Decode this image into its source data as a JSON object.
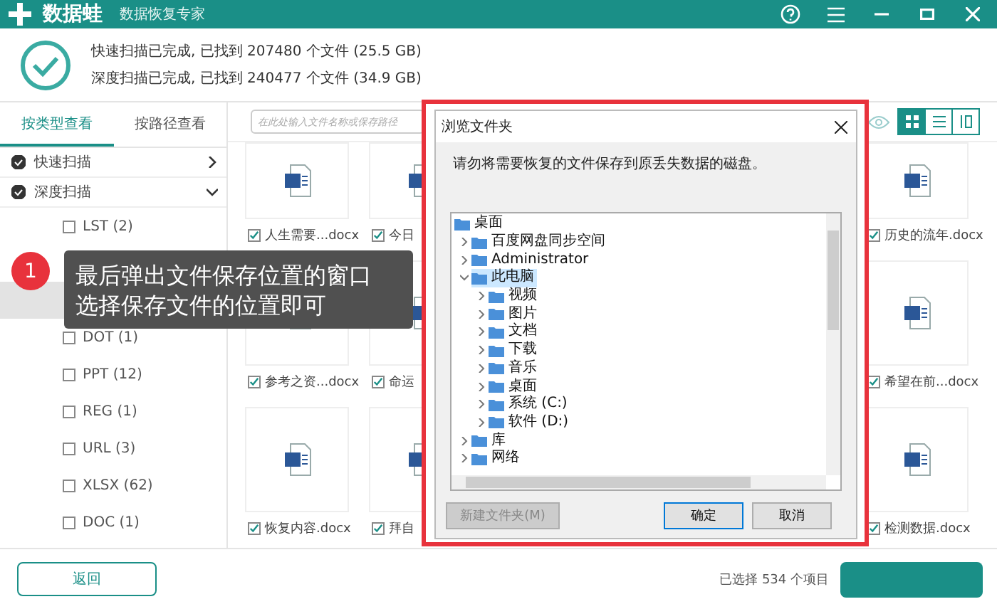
{
  "app": {
    "name": "数据蛙",
    "subtitle": "数据恢复专家"
  },
  "scan_summary": [
    "快速扫描已完成, 已找到 207480 个文件 (25.5 GB)",
    "深度扫描已完成, 已找到 240477 个文件 (34.9 GB)"
  ],
  "view_tabs": [
    {
      "label": "按类型查看",
      "selected": true
    },
    {
      "label": "按路径查看",
      "selected": false
    }
  ],
  "scan_groups": [
    {
      "label": "快速扫描",
      "checked": true,
      "expanded": false
    },
    {
      "label": "深度扫描",
      "checked": true,
      "expanded": true
    }
  ],
  "file_types": [
    {
      "label": "LST (2)",
      "checked": false,
      "selected": false
    },
    {
      "selected": false
    },
    {
      "selected": true
    },
    {
      "label": "DOT (1)",
      "checked": false,
      "selected": false
    },
    {
      "label": "PPT (12)",
      "checked": false,
      "selected": false
    },
    {
      "label": "REG (1)",
      "checked": false,
      "selected": false
    },
    {
      "label": "URL (3)",
      "checked": false,
      "selected": false
    },
    {
      "label": "XLSX (62)",
      "checked": false,
      "selected": false
    },
    {
      "label": "DOC (1)",
      "checked": false,
      "selected": false
    }
  ],
  "search": {
    "placeholder": "在此处输入文件名称或保存路径"
  },
  "view_modes": [
    {
      "kind": "grid",
      "selected": true
    },
    {
      "kind": "list",
      "selected": false
    },
    {
      "kind": "columns",
      "selected": false
    }
  ],
  "file_rows": [
    [
      {
        "name": "人生需要...docx",
        "checked": true
      },
      {
        "name": "今日",
        "checked": true
      },
      {
        "name": "历史的流年.docx",
        "checked": true
      }
    ],
    [
      {
        "name": "参考之资...docx",
        "checked": true
      },
      {
        "name": "命运",
        "checked": true
      },
      {
        "name": "希望在前...docx",
        "checked": true
      }
    ],
    [
      {
        "name": "恢复内容.docx",
        "checked": true
      },
      {
        "name": "拜自",
        "checked": true
      },
      {
        "name": "检测数据.docx",
        "checked": true
      }
    ]
  ],
  "tooltip": {
    "badge": "1",
    "lines": [
      "最后弹出文件保存位置的窗口",
      "选择保存文件的位置即可"
    ]
  },
  "dialog": {
    "title": "浏览文件夹",
    "message": "请勿将需要恢复的文件保存到原丢失数据的磁盘。",
    "tree": [
      {
        "label": "桌面",
        "selected": false,
        "children": [
          {
            "label": "百度网盘同步空间",
            "expanded": false,
            "selected": false
          },
          {
            "label": "Administrator",
            "expanded": false,
            "selected": false
          },
          {
            "label": "此电脑",
            "expanded": true,
            "selected": true,
            "children": [
              {
                "label": "视频",
                "expanded": false,
                "selected": false
              },
              {
                "label": "图片",
                "expanded": false,
                "selected": false
              },
              {
                "label": "文档",
                "expanded": false,
                "selected": false
              },
              {
                "label": "下载",
                "expanded": false,
                "selected": false
              },
              {
                "label": "音乐",
                "expanded": false,
                "selected": false
              },
              {
                "label": "桌面",
                "expanded": false,
                "selected": false
              },
              {
                "label": "系统 (C:)",
                "expanded": false,
                "selected": false
              },
              {
                "label": "软件 (D:)",
                "expanded": false,
                "selected": false
              }
            ]
          },
          {
            "label": "库",
            "expanded": false,
            "selected": false
          },
          {
            "label": "网络",
            "expanded": false,
            "selected": false
          }
        ]
      }
    ],
    "buttons": [
      {
        "label": "新建文件夹(M)",
        "disabled": true,
        "default": false
      },
      {
        "label": "确定",
        "disabled": false,
        "default": true
      },
      {
        "label": "取消",
        "disabled": false,
        "default": false
      }
    ]
  },
  "footer": {
    "back_button": "返回",
    "selection_status": "已选择 534 个项目"
  }
}
